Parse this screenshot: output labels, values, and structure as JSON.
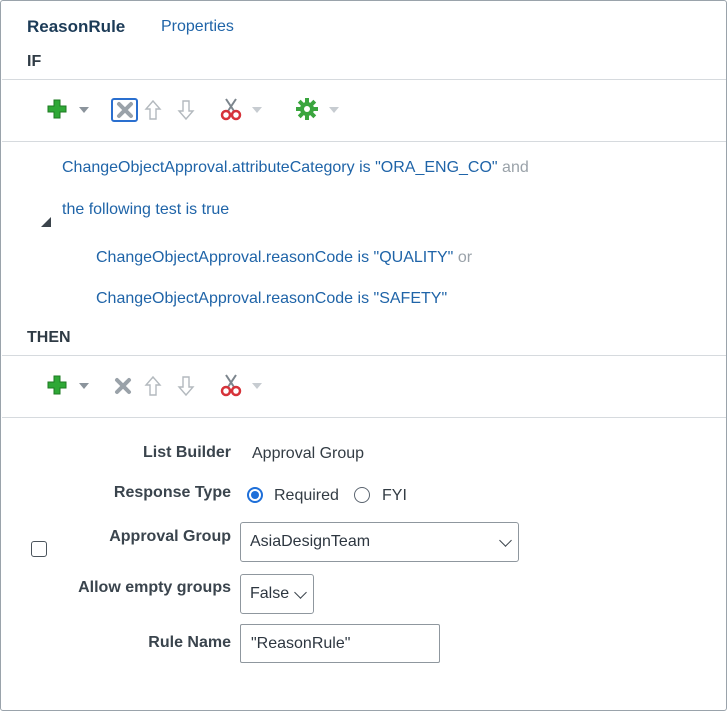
{
  "header": {
    "title": "ReasonRule",
    "properties_link": "Properties"
  },
  "if_section": {
    "title": "IF",
    "conditions": [
      {
        "attr": "ChangeObjectApproval.attributeCategory",
        "op": "is",
        "value": "\"ORA_ENG_CO\"",
        "join": "and"
      },
      {
        "nested_label": "the following test is true"
      },
      {
        "attr": "ChangeObjectApproval.reasonCode",
        "op": "is",
        "value": "\"QUALITY\"",
        "join": "or"
      },
      {
        "attr": "ChangeObjectApproval.reasonCode",
        "op": "is",
        "value": "\"SAFETY\""
      }
    ]
  },
  "then_section": {
    "title": "THEN"
  },
  "form": {
    "list_builder_label": "List Builder",
    "list_builder_value": "Approval Group",
    "response_type_label": "Response Type",
    "response_options": [
      "Required",
      "FYI"
    ],
    "response_selected": "Required",
    "approval_group_label": "Approval Group",
    "approval_group_value": "AsiaDesignTeam",
    "allow_empty_label": "Allow empty groups",
    "allow_empty_value": "False",
    "rule_name_label": "Rule Name",
    "rule_name_value": "\"ReasonRule\""
  },
  "colors": {
    "link": "#1f64a8",
    "add_green": "#2fa836",
    "cut_red": "#d6333a",
    "radio_blue": "#1e6fd9"
  }
}
